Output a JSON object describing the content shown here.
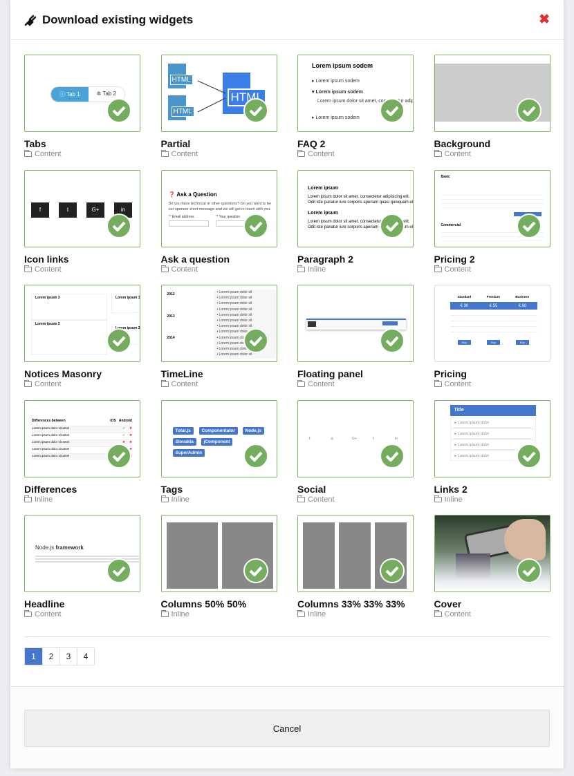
{
  "dialog": {
    "title": "Download existing widgets",
    "icon": "plug-icon",
    "close_icon": "close-icon"
  },
  "widgets": [
    {
      "name": "Tabs",
      "category": "Content",
      "downloaded": true,
      "preview": [
        "Tab 1",
        "Tab 2"
      ]
    },
    {
      "name": "Partial",
      "category": "Content",
      "downloaded": true,
      "preview": [
        "HTML",
        "HTML",
        "HTML"
      ]
    },
    {
      "name": "FAQ 2",
      "category": "Content",
      "downloaded": true,
      "preview": [
        "Lorem ipsum sodem",
        "Lorem ipsum sodem",
        "Lorem ipsum sodem",
        "Lorem ipsum dolor sit amet, consectetur adipisic",
        "Lorem ipsum sodem"
      ]
    },
    {
      "name": "Background",
      "category": "Content",
      "downloaded": true
    },
    {
      "name": "Icon links",
      "category": "Content",
      "downloaded": true,
      "preview": [
        "f",
        "t",
        "G+",
        "in"
      ]
    },
    {
      "name": "Ask a question",
      "category": "Content",
      "downloaded": true,
      "preview": [
        "Ask a Question",
        "Do you have technical or other questions? Do you want to be our sponsor short message and we will get in touch with you.",
        "Email address",
        "Your question"
      ]
    },
    {
      "name": "Paragraph 2",
      "category": "Inline",
      "downloaded": true,
      "preview": [
        "Lorem ipsum",
        "Lorem ipsum dolor sit amet, consectetur adipisicing elit. Odit iste pariatur iure corporis aperiam quasi quisquam elit.",
        "Lorem ipsum",
        "Lorem ipsum dolor sit amet, consectetur adipisicing elit. Odit iste pariatur iure corporis aperiam quasi quisquam elit."
      ]
    },
    {
      "name": "Pricing 2",
      "category": "Content",
      "downloaded": true,
      "preview": [
        "Basic",
        "Commercial"
      ]
    },
    {
      "name": "Notices Masonry",
      "category": "Content",
      "downloaded": true,
      "preview": [
        "Lorem ipsum 3",
        "Lorem ipsum 1",
        "Lorem ipsum 2",
        "Lorem ipsum 3"
      ]
    },
    {
      "name": "TimeLine",
      "category": "Content",
      "downloaded": true,
      "preview": [
        "2012",
        "2013",
        "2014",
        "Lorem ipsum dolor sit"
      ]
    },
    {
      "name": "Floating panel",
      "category": "Content",
      "downloaded": true
    },
    {
      "name": "Pricing",
      "category": "Content",
      "downloaded": false,
      "preview": [
        "Standard",
        "Premium",
        "Business",
        "€ 30",
        "€ 55",
        "€ 60",
        "Buy"
      ]
    },
    {
      "name": "Differences",
      "category": "Inline",
      "downloaded": true,
      "preview": [
        "Differences between",
        "iOS",
        "Android",
        "Lorem ipsum dolor sit amet"
      ]
    },
    {
      "name": "Tags",
      "category": "Inline",
      "downloaded": true,
      "preview": [
        "Total.js",
        "Componentator",
        "Node.js",
        "Slovakia",
        "jComponent",
        "SuperAdmin"
      ]
    },
    {
      "name": "Social",
      "category": "Content",
      "downloaded": true,
      "preview": [
        "f",
        "◎",
        "G+",
        "t",
        "in"
      ]
    },
    {
      "name": "Links 2",
      "category": "Inline",
      "downloaded": true,
      "preview": [
        "Title",
        "Lorem ipsum dolor"
      ]
    },
    {
      "name": "Headline",
      "category": "Content",
      "downloaded": true,
      "preview": [
        "Node.js",
        "framework"
      ]
    },
    {
      "name": "Columns 50% 50%",
      "category": "Inline",
      "downloaded": true
    },
    {
      "name": "Columns 33% 33% 33%",
      "category": "Inline",
      "downloaded": true
    },
    {
      "name": "Cover",
      "category": "Content",
      "downloaded": true
    }
  ],
  "pagination": {
    "pages": [
      "1",
      "2",
      "3",
      "4"
    ],
    "current": "1"
  },
  "footer": {
    "cancel_label": "Cancel"
  },
  "colors": {
    "selected_border": "#7cb260",
    "check": "#74ad5d",
    "accent": "#4676c9",
    "close": "#e0302a"
  }
}
